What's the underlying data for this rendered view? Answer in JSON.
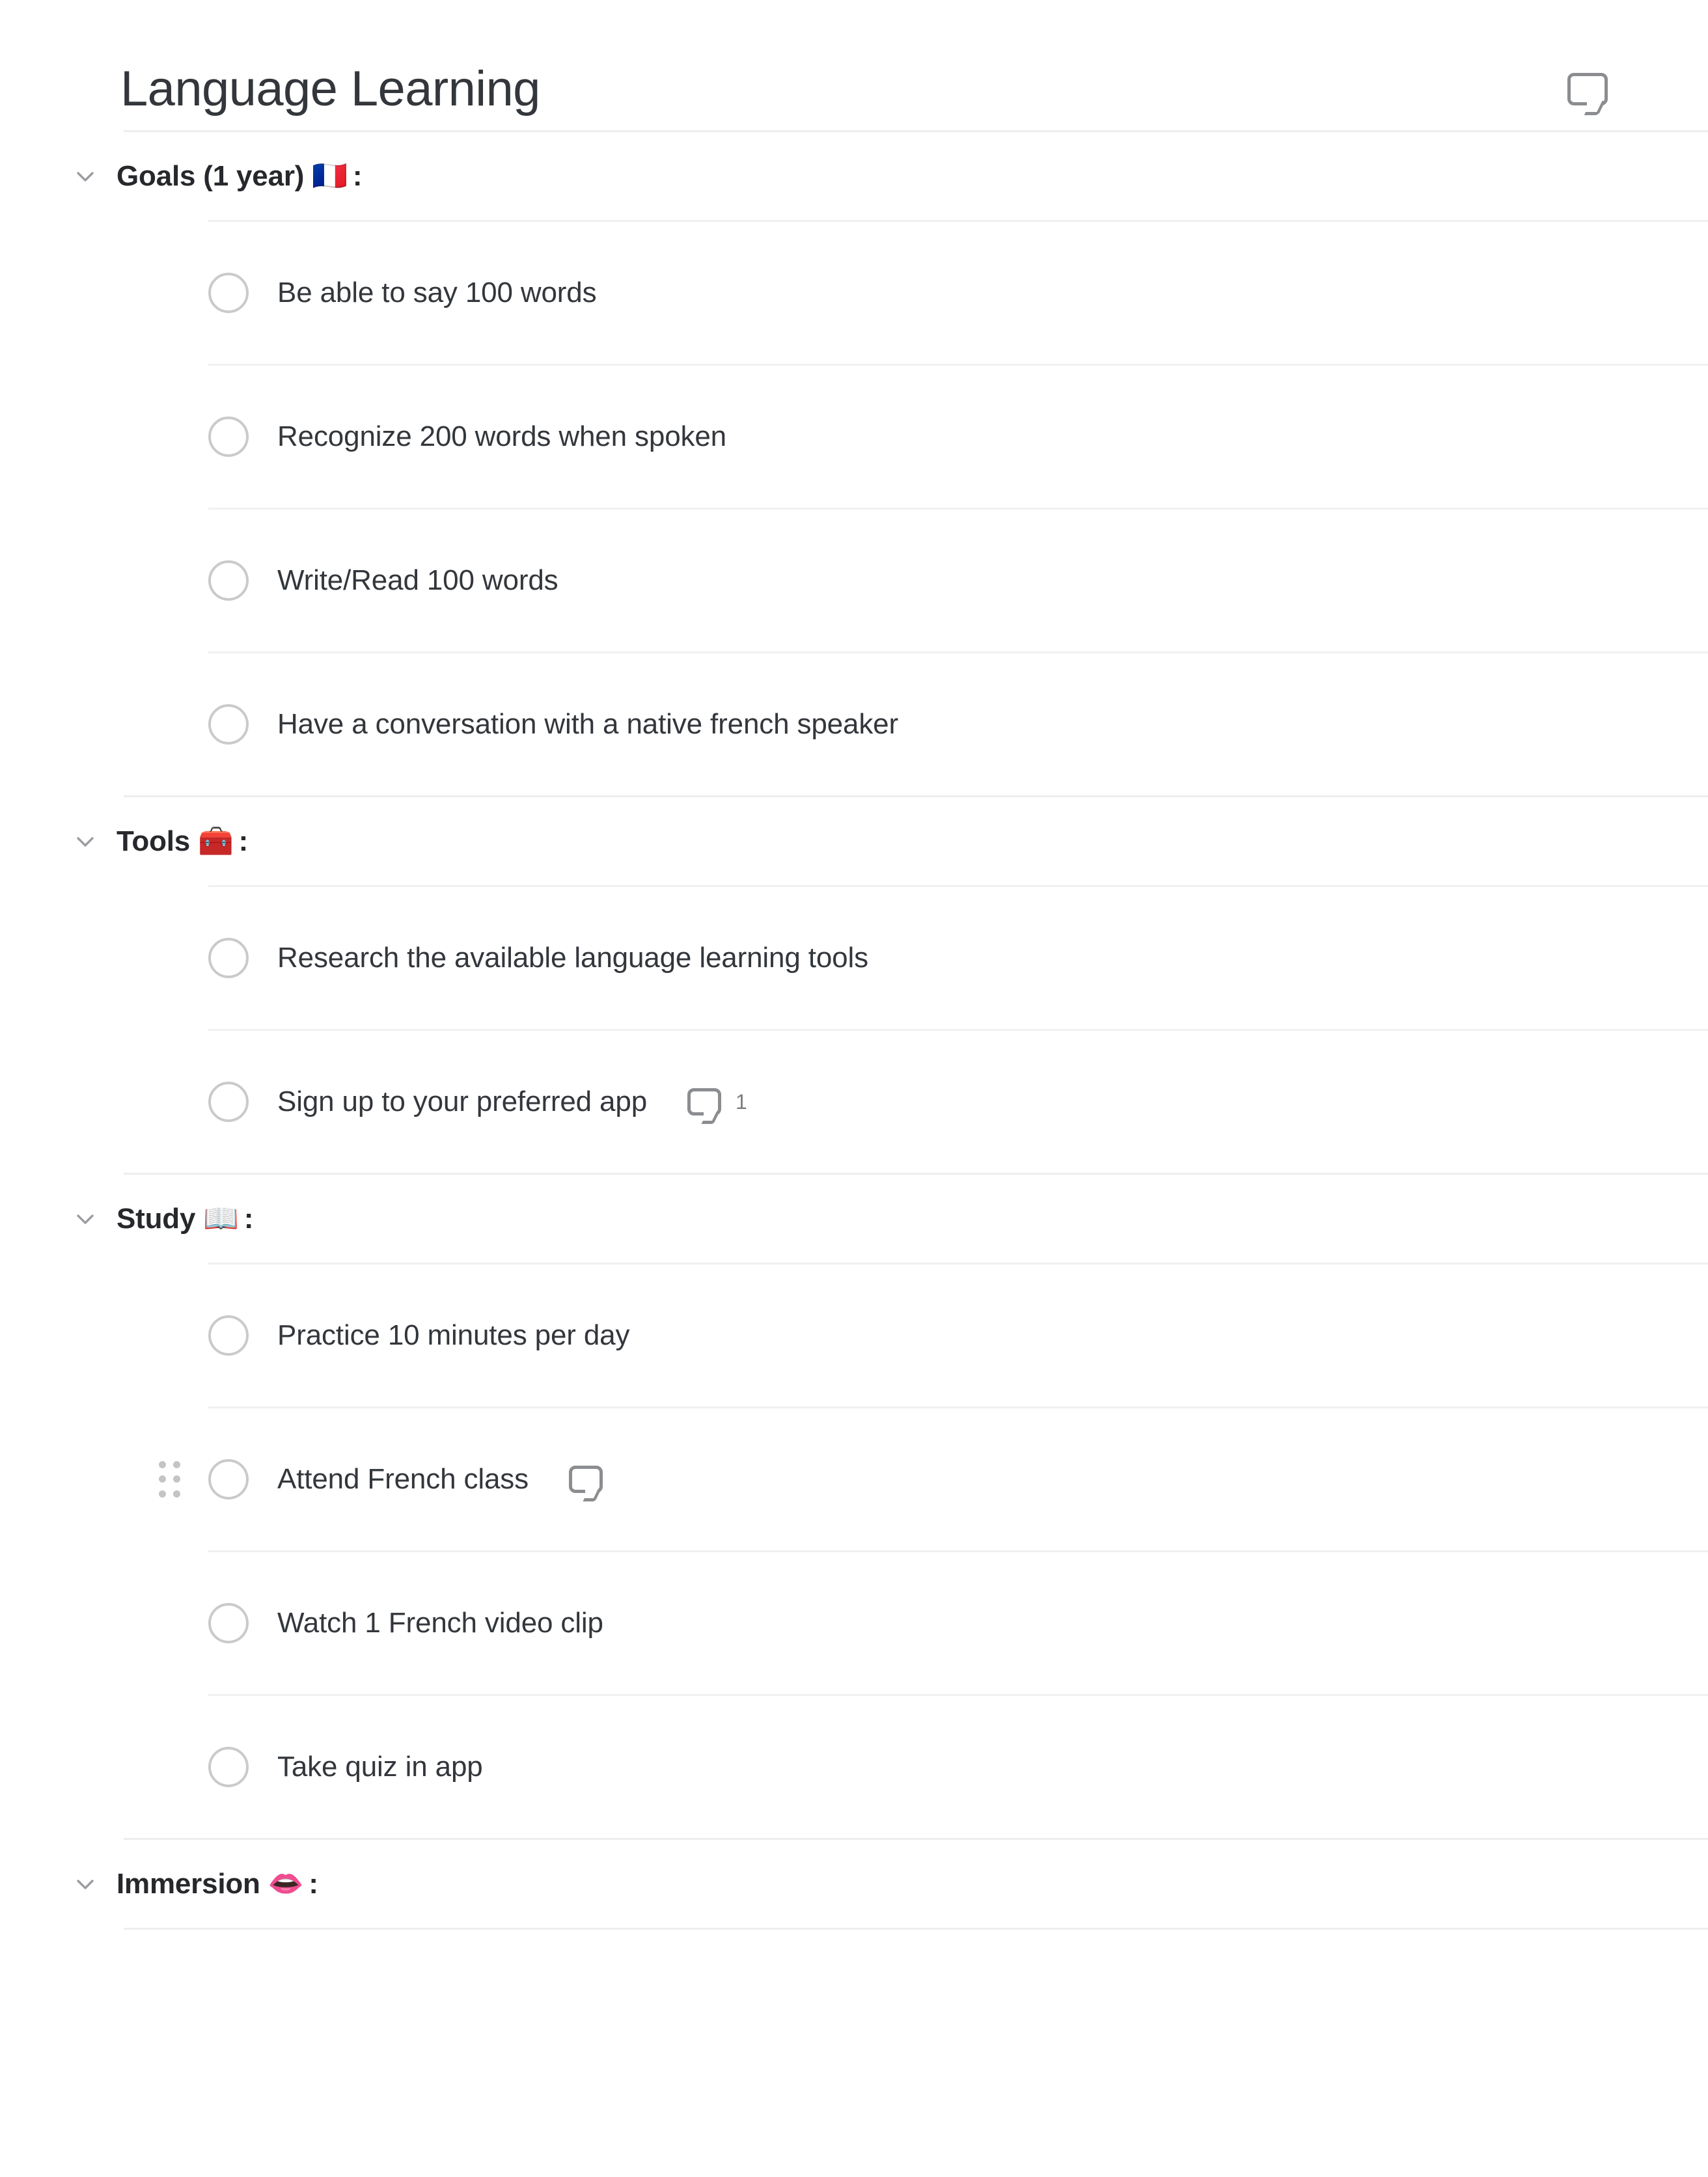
{
  "document": {
    "title": "Language Learning",
    "comment_icon": "comment-bubble-icon"
  },
  "icons": {
    "chevron_down": "chevron-down-icon",
    "drag_handle": "drag-handle-icon",
    "checkbox_empty": "checkbox-empty-icon",
    "comment": "comment-bubble-icon"
  },
  "colors": {
    "text_primary": "#33373c",
    "text_heading": "#26282c",
    "divider": "#eeeef0",
    "checkbox_border": "#c9cacc",
    "icon_gray": "#8b8d90",
    "drag_dot": "#c3c4c6"
  },
  "sections": [
    {
      "label": "Goals (1 year)",
      "emoji": "🇫🇷",
      "emoji_name": "flag-france-emoji",
      "colon": ":",
      "expanded": true,
      "tasks": [
        {
          "label": "Be able to say 100 words",
          "checked": false,
          "comment_count": null,
          "show_comment": false,
          "show_handle": false
        },
        {
          "label": "Recognize 200 words when spoken",
          "checked": false,
          "comment_count": null,
          "show_comment": false,
          "show_handle": false
        },
        {
          "label": "Write/Read 100 words",
          "checked": false,
          "comment_count": null,
          "show_comment": false,
          "show_handle": false
        },
        {
          "label": "Have a conversation with a native french speaker",
          "checked": false,
          "comment_count": null,
          "show_comment": false,
          "show_handle": false
        }
      ]
    },
    {
      "label": "Tools",
      "emoji": "🧰",
      "emoji_name": "toolbox-emoji",
      "colon": ":",
      "expanded": true,
      "tasks": [
        {
          "label": "Research the available language learning tools",
          "checked": false,
          "comment_count": null,
          "show_comment": false,
          "show_handle": false
        },
        {
          "label": "Sign up to your preferred app",
          "checked": false,
          "comment_count": "1",
          "show_comment": true,
          "show_handle": false
        }
      ]
    },
    {
      "label": "Study",
      "emoji": "📖",
      "emoji_name": "open-book-emoji",
      "colon": ":",
      "expanded": true,
      "tasks": [
        {
          "label": "Practice 10 minutes per day",
          "checked": false,
          "comment_count": null,
          "show_comment": false,
          "show_handle": false
        },
        {
          "label": "Attend French class",
          "checked": false,
          "comment_count": "",
          "show_comment": true,
          "show_handle": true
        },
        {
          "label": "Watch 1 French video clip",
          "checked": false,
          "comment_count": null,
          "show_comment": false,
          "show_handle": false
        },
        {
          "label": "Take quiz in app",
          "checked": false,
          "comment_count": null,
          "show_comment": false,
          "show_handle": false
        }
      ]
    },
    {
      "label": "Immersion",
      "emoji": "👄",
      "emoji_name": "mouth-emoji",
      "colon": ":",
      "expanded": true,
      "tasks": []
    }
  ]
}
